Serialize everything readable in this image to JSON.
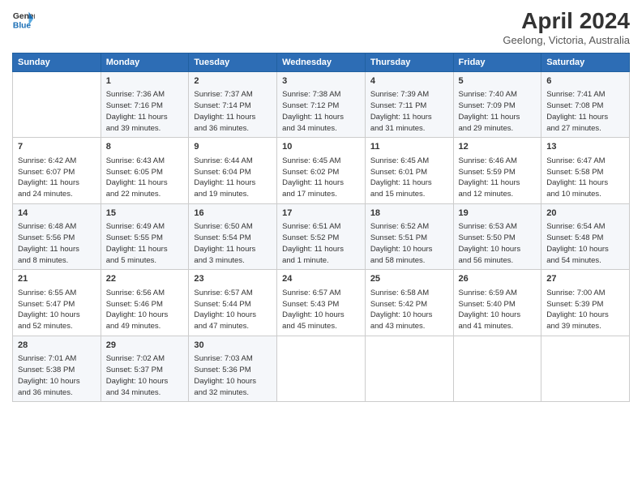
{
  "logo": {
    "line1": "General",
    "line2": "Blue"
  },
  "title": "April 2024",
  "subtitle": "Geelong, Victoria, Australia",
  "days_header": [
    "Sunday",
    "Monday",
    "Tuesday",
    "Wednesday",
    "Thursday",
    "Friday",
    "Saturday"
  ],
  "weeks": [
    [
      {
        "num": "",
        "info": ""
      },
      {
        "num": "1",
        "info": "Sunrise: 7:36 AM\nSunset: 7:16 PM\nDaylight: 11 hours\nand 39 minutes."
      },
      {
        "num": "2",
        "info": "Sunrise: 7:37 AM\nSunset: 7:14 PM\nDaylight: 11 hours\nand 36 minutes."
      },
      {
        "num": "3",
        "info": "Sunrise: 7:38 AM\nSunset: 7:12 PM\nDaylight: 11 hours\nand 34 minutes."
      },
      {
        "num": "4",
        "info": "Sunrise: 7:39 AM\nSunset: 7:11 PM\nDaylight: 11 hours\nand 31 minutes."
      },
      {
        "num": "5",
        "info": "Sunrise: 7:40 AM\nSunset: 7:09 PM\nDaylight: 11 hours\nand 29 minutes."
      },
      {
        "num": "6",
        "info": "Sunrise: 7:41 AM\nSunset: 7:08 PM\nDaylight: 11 hours\nand 27 minutes."
      }
    ],
    [
      {
        "num": "7",
        "info": "Sunrise: 6:42 AM\nSunset: 6:07 PM\nDaylight: 11 hours\nand 24 minutes."
      },
      {
        "num": "8",
        "info": "Sunrise: 6:43 AM\nSunset: 6:05 PM\nDaylight: 11 hours\nand 22 minutes."
      },
      {
        "num": "9",
        "info": "Sunrise: 6:44 AM\nSunset: 6:04 PM\nDaylight: 11 hours\nand 19 minutes."
      },
      {
        "num": "10",
        "info": "Sunrise: 6:45 AM\nSunset: 6:02 PM\nDaylight: 11 hours\nand 17 minutes."
      },
      {
        "num": "11",
        "info": "Sunrise: 6:45 AM\nSunset: 6:01 PM\nDaylight: 11 hours\nand 15 minutes."
      },
      {
        "num": "12",
        "info": "Sunrise: 6:46 AM\nSunset: 5:59 PM\nDaylight: 11 hours\nand 12 minutes."
      },
      {
        "num": "13",
        "info": "Sunrise: 6:47 AM\nSunset: 5:58 PM\nDaylight: 11 hours\nand 10 minutes."
      }
    ],
    [
      {
        "num": "14",
        "info": "Sunrise: 6:48 AM\nSunset: 5:56 PM\nDaylight: 11 hours\nand 8 minutes."
      },
      {
        "num": "15",
        "info": "Sunrise: 6:49 AM\nSunset: 5:55 PM\nDaylight: 11 hours\nand 5 minutes."
      },
      {
        "num": "16",
        "info": "Sunrise: 6:50 AM\nSunset: 5:54 PM\nDaylight: 11 hours\nand 3 minutes."
      },
      {
        "num": "17",
        "info": "Sunrise: 6:51 AM\nSunset: 5:52 PM\nDaylight: 11 hours\nand 1 minute."
      },
      {
        "num": "18",
        "info": "Sunrise: 6:52 AM\nSunset: 5:51 PM\nDaylight: 10 hours\nand 58 minutes."
      },
      {
        "num": "19",
        "info": "Sunrise: 6:53 AM\nSunset: 5:50 PM\nDaylight: 10 hours\nand 56 minutes."
      },
      {
        "num": "20",
        "info": "Sunrise: 6:54 AM\nSunset: 5:48 PM\nDaylight: 10 hours\nand 54 minutes."
      }
    ],
    [
      {
        "num": "21",
        "info": "Sunrise: 6:55 AM\nSunset: 5:47 PM\nDaylight: 10 hours\nand 52 minutes."
      },
      {
        "num": "22",
        "info": "Sunrise: 6:56 AM\nSunset: 5:46 PM\nDaylight: 10 hours\nand 49 minutes."
      },
      {
        "num": "23",
        "info": "Sunrise: 6:57 AM\nSunset: 5:44 PM\nDaylight: 10 hours\nand 47 minutes."
      },
      {
        "num": "24",
        "info": "Sunrise: 6:57 AM\nSunset: 5:43 PM\nDaylight: 10 hours\nand 45 minutes."
      },
      {
        "num": "25",
        "info": "Sunrise: 6:58 AM\nSunset: 5:42 PM\nDaylight: 10 hours\nand 43 minutes."
      },
      {
        "num": "26",
        "info": "Sunrise: 6:59 AM\nSunset: 5:40 PM\nDaylight: 10 hours\nand 41 minutes."
      },
      {
        "num": "27",
        "info": "Sunrise: 7:00 AM\nSunset: 5:39 PM\nDaylight: 10 hours\nand 39 minutes."
      }
    ],
    [
      {
        "num": "28",
        "info": "Sunrise: 7:01 AM\nSunset: 5:38 PM\nDaylight: 10 hours\nand 36 minutes."
      },
      {
        "num": "29",
        "info": "Sunrise: 7:02 AM\nSunset: 5:37 PM\nDaylight: 10 hours\nand 34 minutes."
      },
      {
        "num": "30",
        "info": "Sunrise: 7:03 AM\nSunset: 5:36 PM\nDaylight: 10 hours\nand 32 minutes."
      },
      {
        "num": "",
        "info": ""
      },
      {
        "num": "",
        "info": ""
      },
      {
        "num": "",
        "info": ""
      },
      {
        "num": "",
        "info": ""
      }
    ]
  ]
}
